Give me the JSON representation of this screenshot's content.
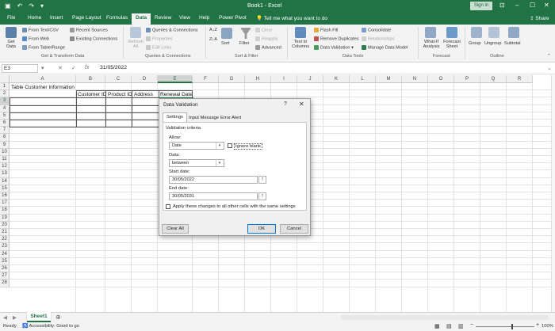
{
  "titlebar": {
    "title": "Book1  -  Excel",
    "signin": "Sign in"
  },
  "tabs": [
    "File",
    "Home",
    "Insert",
    "Page Layout",
    "Formulas",
    "Data",
    "Review",
    "View",
    "Help",
    "Power Pivot"
  ],
  "active_tab": "Data",
  "tell_me": "Tell me what you want to do",
  "share": "Share",
  "ribbon": {
    "get_data": "Get\nData",
    "from_text_csv": "From Text/CSV",
    "from_web": "From Web",
    "from_table_range": "From Table/Range",
    "recent_sources": "Recent Sources",
    "existing_connections": "Existing Connections",
    "group_get_transform": "Get & Transform Data",
    "refresh_all": "Refresh\nAll",
    "queries_connections": "Queries & Connections",
    "properties": "Properties",
    "edit_links": "Edit Links",
    "group_queries": "Queries & Connections",
    "sort_az": "A↓Z",
    "sort_za": "Z↓A",
    "sort": "Sort",
    "filter": "Filter",
    "clear": "Clear",
    "reapply": "Reapply",
    "advanced": "Advanced",
    "group_sort_filter": "Sort & Filter",
    "text_to_columns": "Text to\nColumns",
    "flash_fill": "Flash Fill",
    "remove_duplicates": "Remove Duplicates",
    "data_validation": "Data Validation",
    "consolidate": "Consolidate",
    "relationships": "Relationships",
    "manage_data_model": "Manage Data Model",
    "group_data_tools": "Data Tools",
    "what_if": "What-If\nAnalysis",
    "forecast_sheet": "Forecast\nSheet",
    "group_forecast": "Forecast",
    "group_btn": "Group",
    "ungroup": "Ungroup",
    "subtotal": "Subtotal",
    "group_outline": "Outline"
  },
  "formula_bar": {
    "name_box": "E3",
    "fx": "fx",
    "value": "31/05/2022"
  },
  "columns": [
    "A",
    "B",
    "C",
    "D",
    "E",
    "F",
    "G",
    "H",
    "I",
    "J",
    "K",
    "L",
    "M",
    "N",
    "O",
    "P",
    "Q",
    "R"
  ],
  "rows": [
    "1",
    "2",
    "3",
    "4",
    "5",
    "6",
    "7",
    "8",
    "9",
    "10",
    "11",
    "12",
    "13",
    "14",
    "15",
    "16",
    "17",
    "18",
    "19",
    "20",
    "21",
    "22",
    "23",
    "24",
    "25",
    "26",
    "27",
    "28"
  ],
  "cells": {
    "A1": "Table Customer Information",
    "B2": "Customer ID",
    "C2": "Product ID",
    "D2": "Address",
    "E2": "Renewal Date"
  },
  "sheets": [
    "Sheet1"
  ],
  "status": {
    "ready": "Ready",
    "accessibility": "Accessibility: Good to go",
    "zoom": "100%"
  },
  "dialog": {
    "title": "Data Validation",
    "help": "?",
    "close": "✕",
    "tabs": [
      "Settings",
      "Input Message",
      "Error Alert"
    ],
    "section": "Validation criteria",
    "allow_label": "Allow:",
    "allow_value": "Date",
    "ignore_blank": "Ignore blank",
    "data_label": "Data:",
    "data_value": "between",
    "start_label": "Start date:",
    "start_value": "30/05/2022",
    "end_label": "End date:",
    "end_value": "30/05/2031",
    "apply_all": "Apply these changes to all other cells with the same settings",
    "clear_all": "Clear All",
    "ok": "OK",
    "cancel": "Cancel"
  },
  "colors": {
    "accent": "#217346",
    "dialog_bg": "#f0f0f0"
  }
}
